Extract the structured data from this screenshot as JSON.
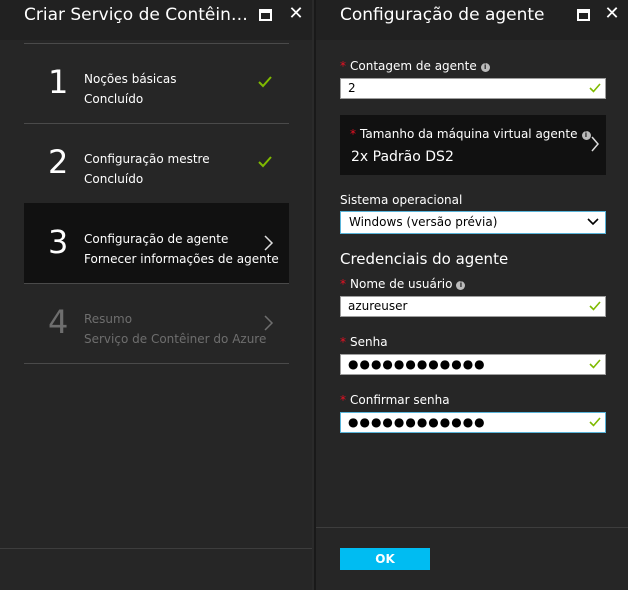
{
  "left_blade": {
    "title": "Criar Serviço de Contêiner d...",
    "maximize_icon": "maximize-icon",
    "close_icon": "close-icon",
    "steps": [
      {
        "number": "1",
        "title": "Noções básicas",
        "subtitle": "Concluído",
        "state": "complete"
      },
      {
        "number": "2",
        "title": "Configuração mestre",
        "subtitle": "Concluído",
        "state": "complete"
      },
      {
        "number": "3",
        "title": "Configuração de agente",
        "subtitle": "Fornecer informações de agente",
        "state": "active"
      },
      {
        "number": "4",
        "title": "Resumo",
        "subtitle": "Serviço de Contêiner do Azure",
        "state": "disabled"
      }
    ]
  },
  "right_blade": {
    "title": "Configuração de agente",
    "agent_count": {
      "required_mark": "*",
      "label": "Contagem de agente",
      "value": "2"
    },
    "vm_size": {
      "required_mark": "*",
      "label": "Tamanho da máquina virtual agente",
      "value": "2x Padrão DS2"
    },
    "os": {
      "label": "Sistema operacional",
      "selected": "Windows (versão prévia)"
    },
    "credentials_title": "Credenciais do agente",
    "username": {
      "required_mark": "*",
      "label": "Nome de usuário",
      "value": "azureuser"
    },
    "password": {
      "required_mark": "*",
      "label": "Senha",
      "value": "●●●●●●●●●●●●"
    },
    "confirm_password": {
      "required_mark": "*",
      "label": "Confirmar senha",
      "value": "●●●●●●●●●●●●"
    },
    "ok_label": "OK"
  },
  "colors": {
    "accent": "#00bcf2",
    "check_green": "#7fba00",
    "required_red": "#e81123",
    "focus_border": "#59b4d9",
    "panel_bg": "#262626"
  }
}
